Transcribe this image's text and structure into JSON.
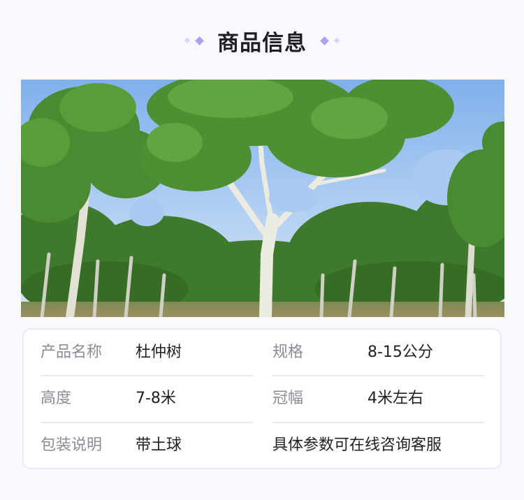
{
  "header": {
    "title": "商品信息"
  },
  "photo": {
    "alt": "杜仲树"
  },
  "specs": {
    "row1": {
      "label_a": "产品名称",
      "value_a": "杜仲树",
      "label_b": "规格",
      "value_b": "8-15公分"
    },
    "row2": {
      "label_a": "高度",
      "value_a": "7-8米",
      "label_b": "冠幅",
      "value_b": "4米左右"
    },
    "row3": {
      "label_a": "包装说明",
      "value_a": "带土球",
      "note": "具体参数可在线咨询客服"
    }
  },
  "colors": {
    "accent": "#a9a3f2",
    "accent_light": "#d9d6fb",
    "background": "#f8f8fd",
    "card_border": "#e9e8f7"
  }
}
